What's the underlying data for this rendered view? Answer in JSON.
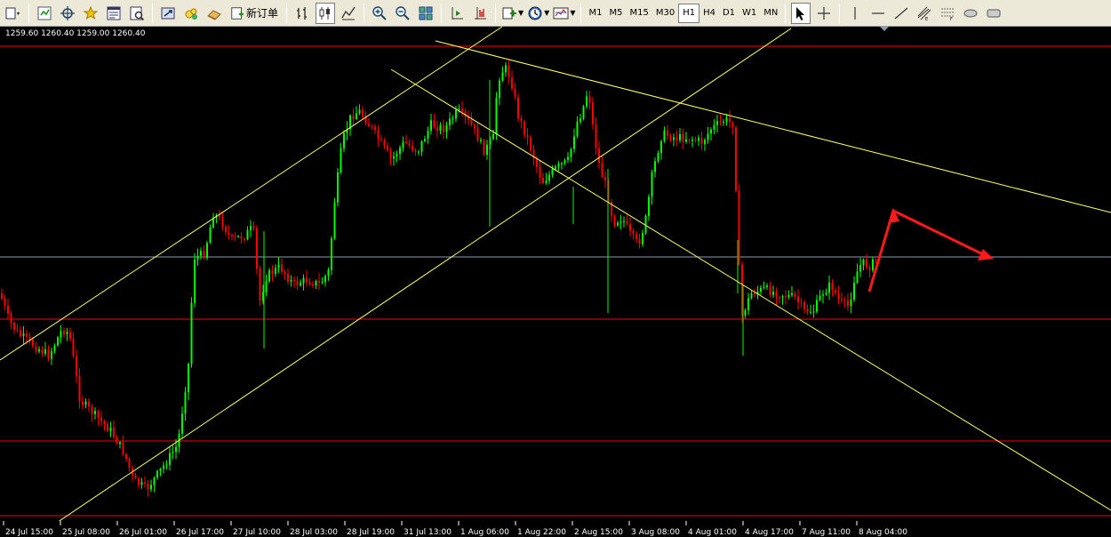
{
  "toolbar": {
    "new_order_label": "新订单",
    "timeframes": [
      "M1",
      "M5",
      "M15",
      "M30",
      "H1",
      "H4",
      "D1",
      "W1",
      "MN"
    ],
    "active_timeframe": "H1"
  },
  "chart": {
    "ohlc_text": "1259.60 1260.40 1259.00 1260.40",
    "time_labels": [
      "24 Jul 15:00",
      "25 Jul 08:00",
      "26 Jul 01:00",
      "26 Jul 17:00",
      "27 Jul 10:00",
      "28 Jul 03:00",
      "28 Jul 19:00",
      "31 Jul 13:00",
      "1 Aug 06:00",
      "1 Aug 22:00",
      "2 Aug 15:00",
      "3 Aug 08:00",
      "4 Aug 01:00",
      "4 Aug 17:00",
      "7 Aug 11:00",
      "8 Aug 04:00"
    ],
    "colors": {
      "background": "#000000",
      "bull": "#00ff00",
      "bear": "#ff0000",
      "trendline": "#ffff66",
      "horizontal_level": "#ff0000",
      "current_price_line": "#8a9bb0",
      "arrow": "#ff1a1a"
    }
  }
}
